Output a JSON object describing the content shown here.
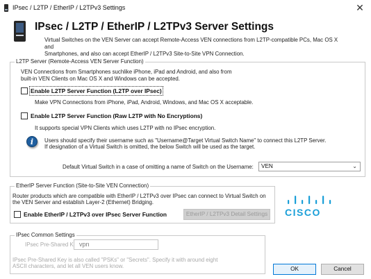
{
  "window": {
    "title": "IPsec / L2TP / EtherIP / L2TPv3 Settings",
    "close_glyph": "✕"
  },
  "header": {
    "title": "IPsec / L2TP / EtherIP / L2TPv3 Server Settings",
    "description_line1": "Virtual Switches on the VEN Server can accept Remote-Access VEN connections from L2TP-compatible PCs, Mac OS X and",
    "description_line2": "Smartphones, and also can accept EtherIP / L2TPv3 Site-to-Site VPN Connection.",
    "icon": "server-device-icon"
  },
  "l2tp_group": {
    "title": "L2TP Server (Remote-Access VEN Server Function)",
    "intro_line1": "VEN Connections from Smartphones suchlike iPhone, iPad and Android, and also from",
    "intro_line2": "built-in VEN Clients on Mac OS X and Windows can be accepted.",
    "checkbox1_label": "Enable L2TP Server Function (L2TP over IPsec)",
    "checkbox1_checked": false,
    "checkbox1_note": "Make VPN Connections from iPhone, iPad, Android, Windows, and Mac OS X acceptable.",
    "checkbox2_label": "Enable L2TP Server Function (Raw L2TP with No Encryptions)",
    "checkbox2_checked": false,
    "checkbox2_note": "It supports special VPN Clients which uses L2TP with no IPsec encryption.",
    "info_line1": "Users should specify their username such as \"Username@Target Virtual Switch Name\" to connect this L2TP Server.",
    "info_line2": "If designation of a Virtual Switch is omitted, the below Switch will be used as the target.",
    "info_icon": "info-icon",
    "default_switch_label": "Default Virtual Switch in a case of omitting a name of Switch on the Username:",
    "default_switch_value": "VEN",
    "dropdown_arrow": "⌄"
  },
  "etherip_group": {
    "title": "EtherIP Server Function (Site-to-Site VEN Connection)",
    "desc_line1": "Router products which are compatible with EtherIP / L2TPv3 over IPsec can connect to Virtual Switch on",
    "desc_line2": "the VEN Server and establish Layer-2 (Ethernet) Bridging.",
    "checkbox_label": "Enable EtherIP / L2TPv3 over IPsec Server Function",
    "checkbox_checked": false,
    "detail_button": "EtherIP / L2TPv3 Detail Settings",
    "logo_text": "CISCO",
    "accent_color": "#1a9fd8"
  },
  "ipsec_group": {
    "title": "IPsec Common Settings",
    "psk_label": "IPsec Pre-Shared Key:",
    "psk_value": "vpn",
    "note_line1": "IPsec Pre-Shared Key is also called \"PSKs\" or \"Secrets\". Specify it with around eight",
    "note_line2": "ASCII characters, and let all VEN users know."
  },
  "buttons": {
    "ok": "OK",
    "cancel": "Cancel"
  }
}
